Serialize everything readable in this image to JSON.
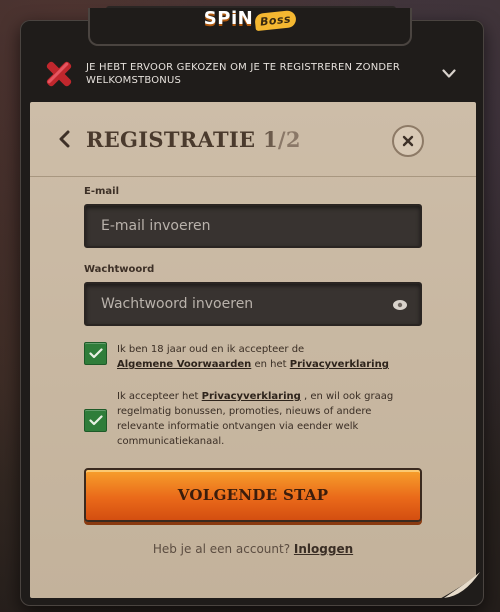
{
  "header": {
    "logo_main": "SPiN",
    "logo_badge": "Boss"
  },
  "banner": {
    "text": "JE HEBT ERVOOR GEKOZEN OM JE TE REGISTREREN ZONDER WELKOMSTBONUS",
    "icon": "close-x-icon",
    "chevron": "chevron-down-icon"
  },
  "card": {
    "title": "REGISTRATIE",
    "step": "1",
    "total": "/2"
  },
  "email": {
    "label": "E-mail",
    "placeholder": "E-mail invoeren"
  },
  "password": {
    "label": "Wachtwoord",
    "placeholder": "Wachtwoord invoeren"
  },
  "consent1": {
    "text_a": "Ik ben 18 jaar oud en ik accepteer de",
    "link_terms": "Algemene Voorwaarden",
    "text_b": "en het",
    "link_privacy": "Privacyverklaring"
  },
  "consent2": {
    "text_a": "Ik accepteer het",
    "link_privacy": "Privacyverklaring",
    "text_b": ", en wil ook graag regelmatig bonussen, promoties, nieuws of andere relevante informatie ontvangen via eender welk communicatiekanaal."
  },
  "next_button": "VOLGENDE STAP",
  "login": {
    "prompt": "Heb je al een account?",
    "link": "Inloggen"
  },
  "colors": {
    "accent": "#ea6a1a",
    "check": "#2f7d3a",
    "paper": "#c6b6a0"
  }
}
